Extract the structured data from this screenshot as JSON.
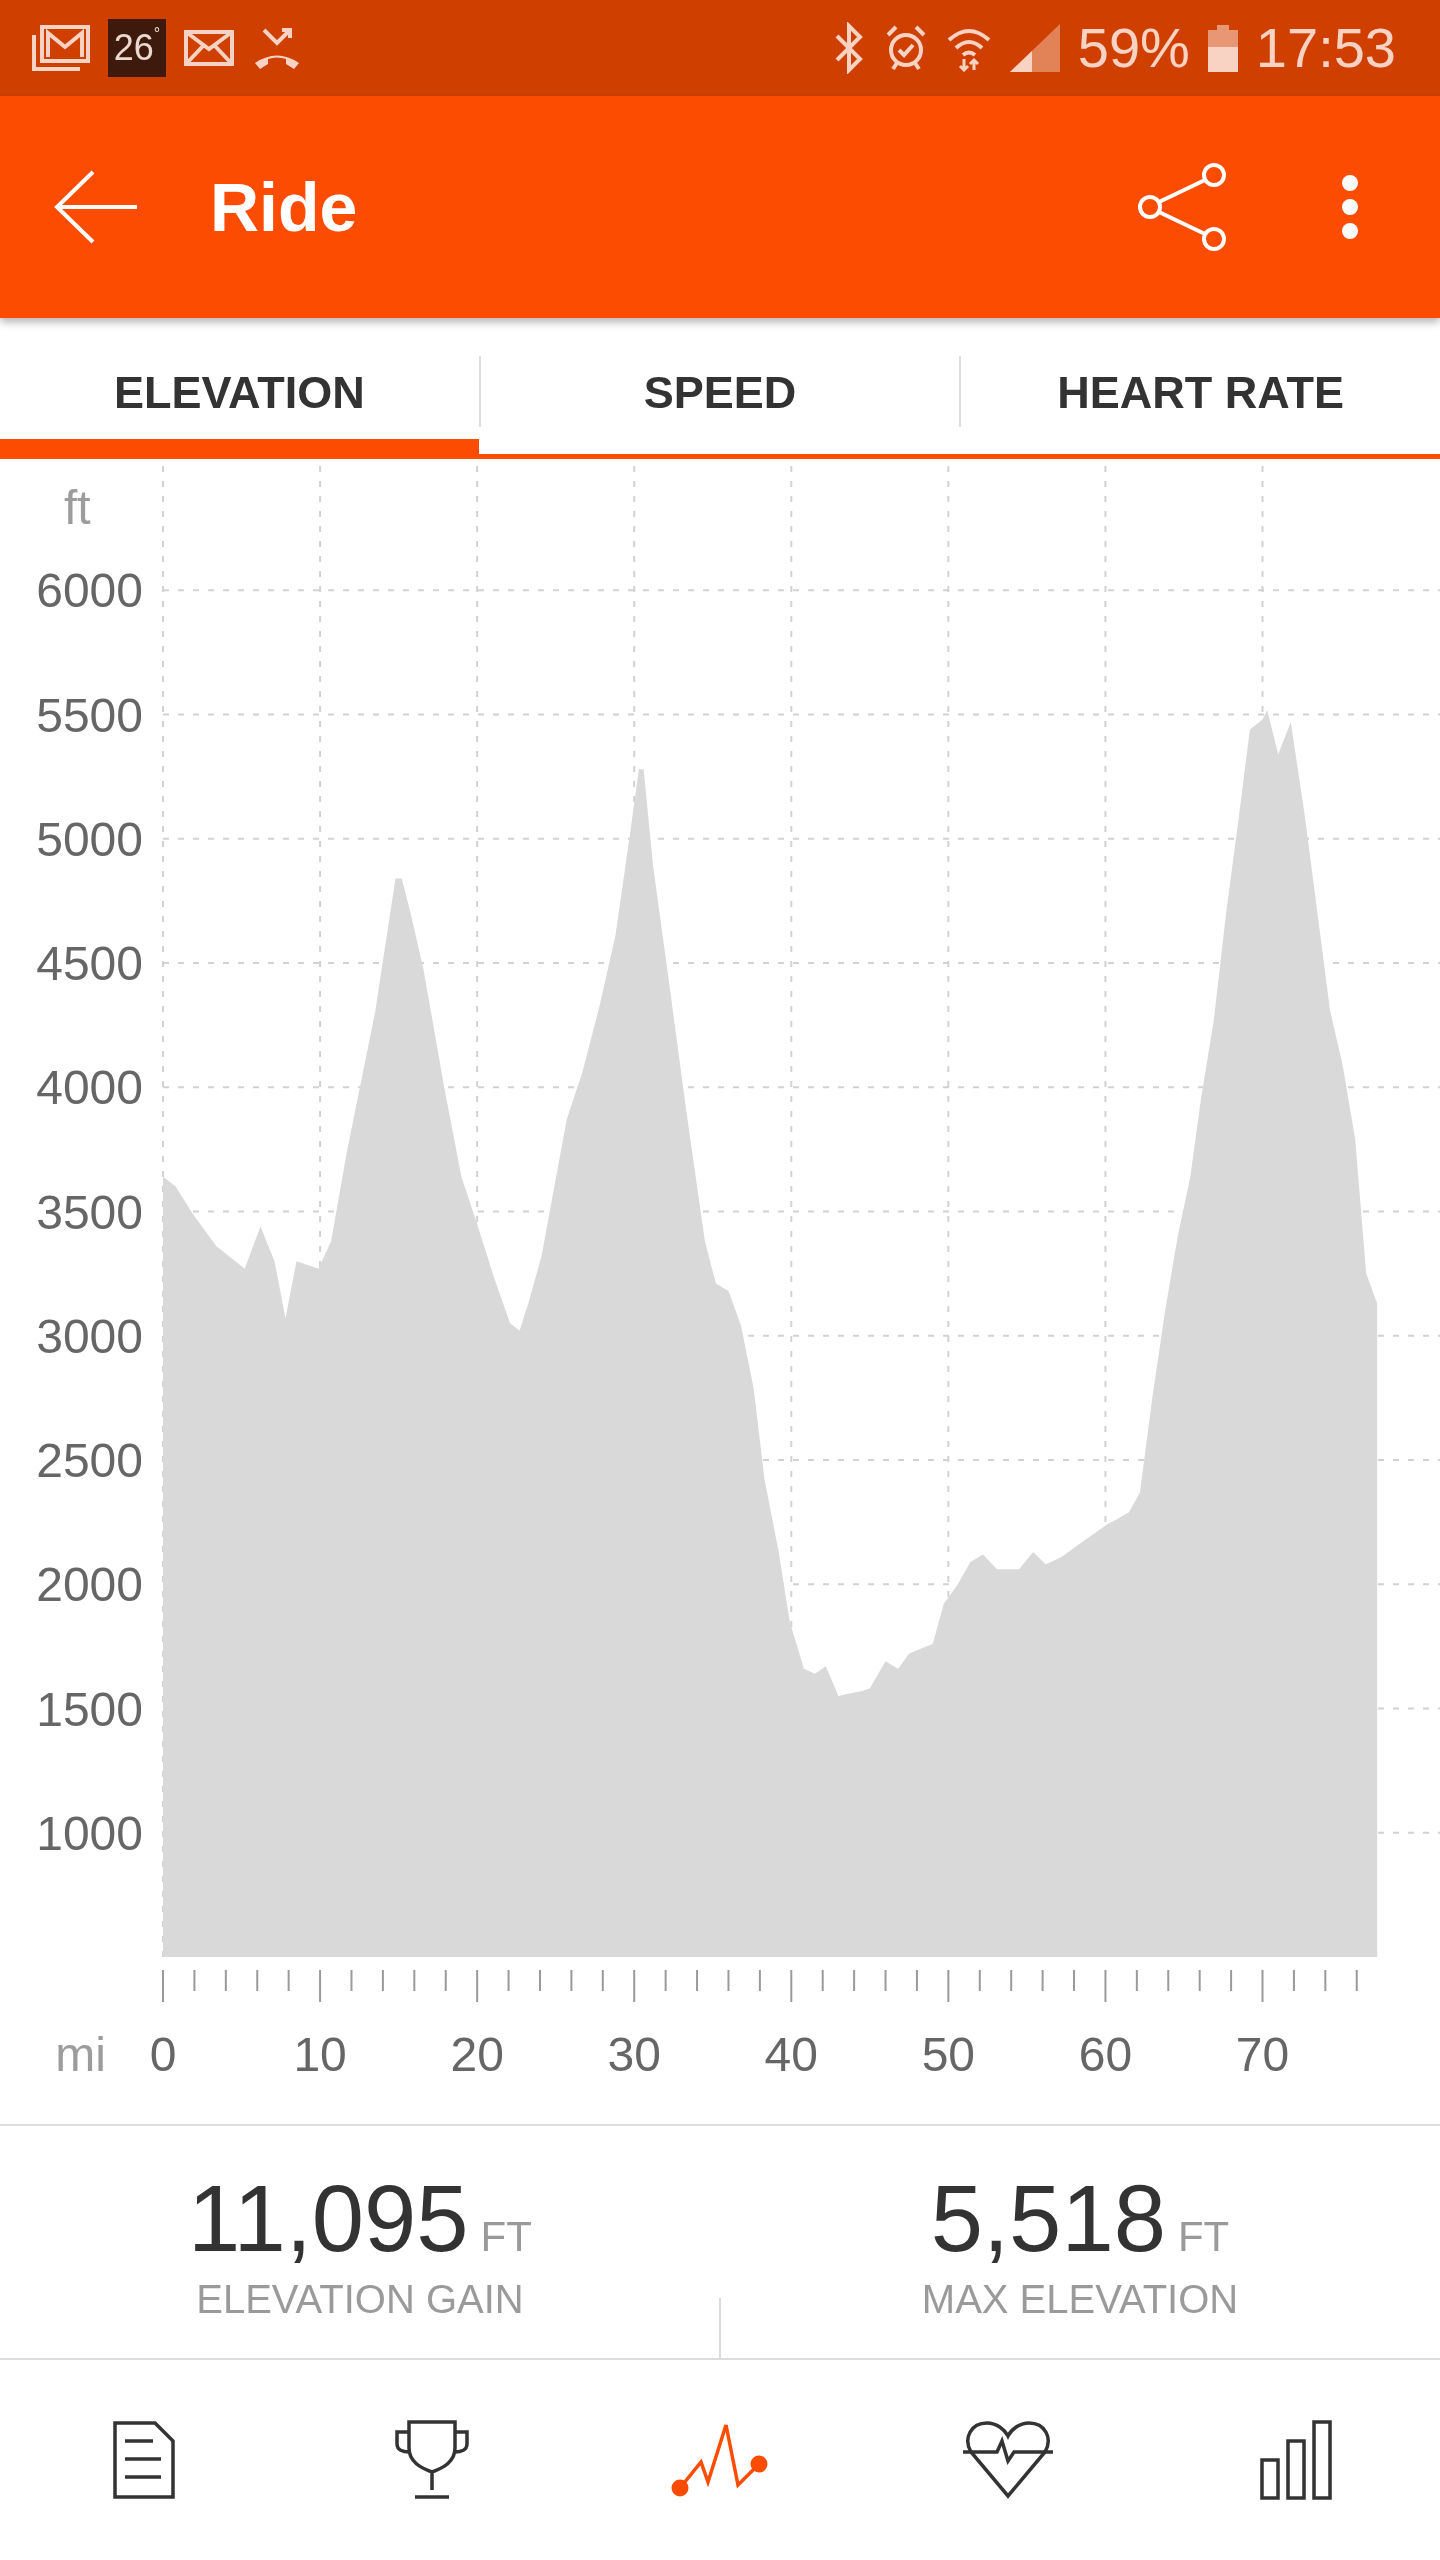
{
  "status_bar": {
    "temperature": "26$^{°}$",
    "battery": "59%",
    "time": "17:53"
  },
  "app_bar": {
    "title": "Ride"
  },
  "tabs": [
    {
      "label": "ELEVATION",
      "selected": true
    },
    {
      "label": "SPEED",
      "selected": false
    },
    {
      "label": "HEART RATE",
      "selected": false
    }
  ],
  "chart": {
    "chart_data": {
      "type": "area",
      "xlabel": "mi",
      "ylabel": "ft",
      "x": [
        0,
        0.8,
        1.9,
        3.4,
        5.2,
        6.2,
        7.1,
        7.8,
        8.5,
        9.9,
        10.7,
        11.7,
        13.5,
        14.8,
        15.2,
        15.8,
        16.6,
        17.9,
        19.0,
        20.0,
        21.1,
        22.1,
        22.7,
        23.3,
        24.1,
        25.7,
        26.7,
        27.8,
        28.8,
        29.8,
        30.3,
        30.6,
        31.2,
        32.2,
        33.3,
        34.5,
        35.2,
        36.0,
        36.8,
        37.6,
        38.3,
        39.2,
        39.9,
        40.8,
        41.5,
        42.2,
        43.0,
        43.7,
        44.5,
        45.0,
        46.0,
        46.8,
        47.5,
        48.2,
        49.0,
        49.7,
        50.6,
        51.4,
        52.2,
        53.1,
        54.5,
        55.4,
        56.2,
        57.2,
        58.3,
        59.2,
        60.1,
        60.7,
        61.5,
        62.2,
        63.0,
        63.8,
        64.6,
        65.4,
        66.1,
        66.9,
        67.7,
        68.5,
        69.2,
        70.0,
        70.3,
        71.0,
        71.8,
        72.7,
        73.6,
        74.3,
        75.1,
        75.9,
        76.6,
        77.3
      ],
      "series": [
        {
          "color": "#d9d9d9",
          "values": [
            3640,
            3600,
            3490,
            3360,
            3270,
            3440,
            3300,
            3070,
            3300,
            3270,
            3380,
            3740,
            4300,
            4840,
            4840,
            4690,
            4470,
            4000,
            3640,
            3450,
            3230,
            3050,
            3020,
            3140,
            3320,
            3870,
            4060,
            4330,
            4610,
            5050,
            5280,
            5280,
            4890,
            4430,
            3910,
            3380,
            3210,
            3180,
            3040,
            2790,
            2420,
            2130,
            1850,
            1660,
            1640,
            1670,
            1550,
            1560,
            1570,
            1580,
            1690,
            1660,
            1720,
            1740,
            1760,
            1920,
            2000,
            2090,
            2120,
            2060,
            2060,
            2130,
            2080,
            2110,
            2160,
            2200,
            2240,
            2260,
            2290,
            2370,
            2760,
            3100,
            3400,
            3640,
            3960,
            4270,
            4710,
            5090,
            5440,
            5480,
            5518,
            5340,
            5470,
            5090,
            4650,
            4310,
            4090,
            3790,
            3250,
            3130
          ]
        }
      ],
      "xlim": [
        0,
        81.3
      ],
      "ylim": [
        500,
        6500
      ],
      "xticks": [
        0,
        10,
        20,
        30,
        40,
        50,
        60,
        70
      ],
      "yticks": [
        1000,
        1500,
        2000,
        2500,
        3000,
        3500,
        4000,
        4500,
        5000,
        5500,
        6000
      ],
      "grid": true
    }
  },
  "stats": [
    {
      "value": "11,095",
      "unit": "FT",
      "label": "ELEVATION GAIN"
    },
    {
      "value": "5,518",
      "unit": "FT",
      "label": "MAX ELEVATION"
    }
  ],
  "bottom_nav": [
    {
      "kind": "document",
      "selected": false
    },
    {
      "kind": "trophy",
      "selected": false
    },
    {
      "kind": "graph",
      "selected": true
    },
    {
      "kind": "heart",
      "selected": false
    },
    {
      "kind": "bars",
      "selected": false
    }
  ]
}
